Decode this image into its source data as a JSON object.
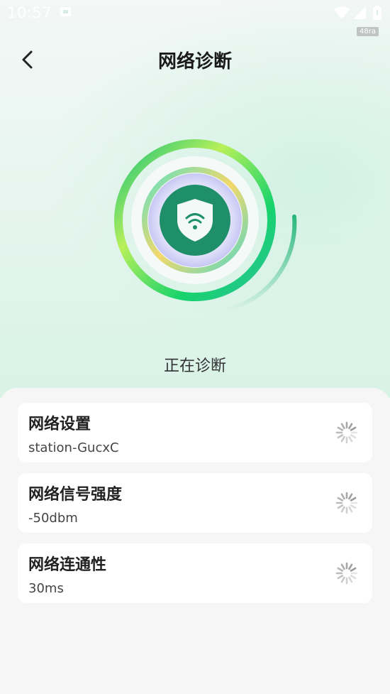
{
  "status_bar": {
    "time": "10:57",
    "badge": "48ra",
    "icons": [
      "notification-icon",
      "wifi-icon",
      "signal-icon",
      "battery-icon"
    ]
  },
  "header": {
    "title": "网络诊断",
    "back_icon": "chevron-left-icon"
  },
  "diagnosis": {
    "status_text": "正在诊断",
    "center_icon": "wifi-shield-icon"
  },
  "checks": [
    {
      "title": "网络设置",
      "value": "station-GucxC",
      "state_icon": "loading-spinner-icon"
    },
    {
      "title": "网络信号强度",
      "value": "-50dbm",
      "state_icon": "loading-spinner-icon"
    },
    {
      "title": "网络连通性",
      "value": "30ms",
      "state_icon": "loading-spinner-icon"
    }
  ],
  "colors": {
    "accent_green": "#1fc77a",
    "accent_lime": "#b8f05a",
    "shield_dark": "#1f8f6a",
    "text_primary": "#222222",
    "text_secondary": "#444444"
  }
}
